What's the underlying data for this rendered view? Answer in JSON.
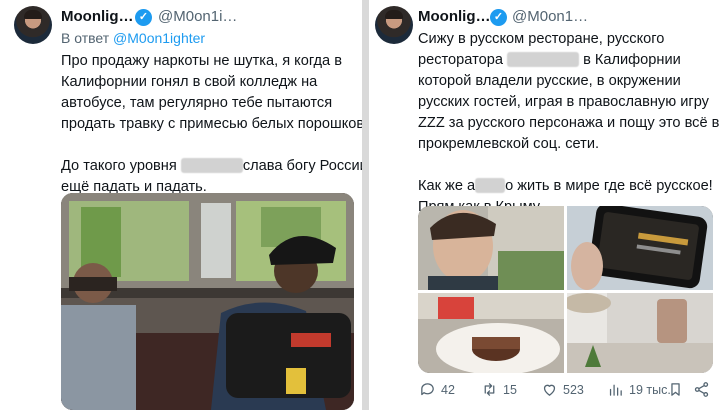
{
  "left": {
    "author_name": "Moonlig…",
    "handle": "@M0on1i…",
    "reply_prefix": "В ответ",
    "reply_mention": "@M0on1ighter",
    "lines": [
      "Про продажу наркоты не шутка, я когда в",
      "Калифорнии гонял в свой колледж на",
      "автобусе, там регулярно тебе пытаются",
      "продать травку с примесью белых порошков."
    ],
    "line5_before": "До такого уровня",
    "line5_after": "слава богу России",
    "line6": "ещё падать и падать."
  },
  "right": {
    "author_name": "Moonlig…",
    "handle": "@M0on1…",
    "line1": "Сижу в русском ресторане, русского",
    "line2_before": "ресторатора",
    "line2_after": "в Калифорнии",
    "lines_mid": [
      "которой владели русские, в окружении",
      "русских гостей, играя в православную игру",
      "ZZZ за русского персонажа и пощу это всё в",
      "прокремлевской соц. сети."
    ],
    "line6_before": "Как же а",
    "line6_after": "о жить в мире где всё русское!",
    "line7": "Прям как в Крыму",
    "actions": {
      "replies": "42",
      "retweets": "15",
      "likes": "523",
      "views": "19 тыс."
    }
  },
  "colors": {
    "accent": "#1d9bf0",
    "secondary_text": "#536471"
  }
}
